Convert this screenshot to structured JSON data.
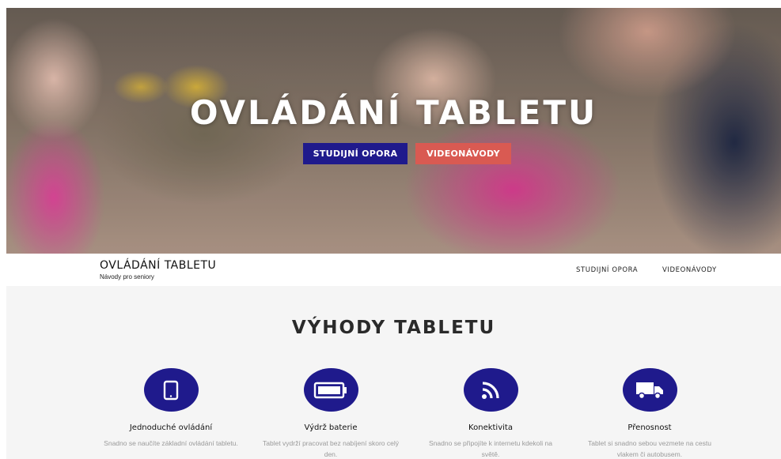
{
  "hero": {
    "title": "OVLÁDÁNÍ TABLETU",
    "primary_button": "STUDIJNÍ OPORA",
    "secondary_button": "VIDEONÁVODY"
  },
  "navbar": {
    "brand_title": "OVLÁDÁNÍ TABLETU",
    "brand_subtitle": "Návody pro seniory",
    "links": [
      "STUDIJNÍ OPORA",
      "VIDEONÁVODY"
    ]
  },
  "features": {
    "title": "VÝHODY TABLETU",
    "items": [
      {
        "icon": "tablet-icon",
        "title": "Jednoduché ovládání",
        "description": "Snadno se naučíte základní ovládání tabletu."
      },
      {
        "icon": "battery-icon",
        "title": "Výdrž baterie",
        "description": "Tablet vydrží pracovat bez nabíjení skoro celý den."
      },
      {
        "icon": "wifi-icon",
        "title": "Konektivita",
        "description": "Snadno se připojíte k internetu kdekoli na světě."
      },
      {
        "icon": "truck-icon",
        "title": "Přenosnost",
        "description": "Tablet si snadno sebou vezmete na cestu vlakem či autobusem."
      }
    ]
  },
  "colors": {
    "primary": "#1f1a8c",
    "accent": "#d95a52"
  }
}
